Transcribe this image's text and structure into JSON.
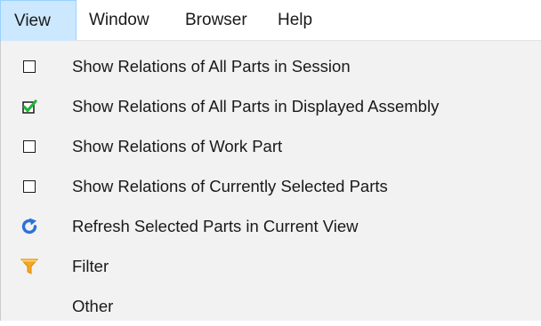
{
  "menubar": {
    "items": [
      {
        "label": "View",
        "active": true
      },
      {
        "label": "Window"
      },
      {
        "label": "Browser"
      },
      {
        "label": "Help"
      }
    ]
  },
  "dropdown": {
    "items": [
      {
        "label": "Show Relations of All Parts in Session",
        "icon": "checkbox-icon",
        "checked": false
      },
      {
        "label": "Show Relations of All Parts in Displayed Assembly",
        "icon": "checkbox-checked-icon",
        "checked": true
      },
      {
        "label": "Show Relations of Work Part",
        "icon": "checkbox-icon",
        "checked": false
      },
      {
        "label": "Show Relations of Currently Selected Parts",
        "icon": "checkbox-icon",
        "checked": false
      },
      {
        "label": "Refresh Selected Parts in Current View",
        "icon": "refresh-icon"
      },
      {
        "label": "Filter",
        "icon": "filter-icon"
      },
      {
        "label": "Other",
        "icon": ""
      }
    ]
  },
  "colors": {
    "active_menu_bg": "#cce8ff",
    "active_menu_border": "#99d1ff",
    "dropdown_bg": "#f2f2f2",
    "check_green": "#1fb53a",
    "refresh_blue": "#2a73d9",
    "filter_orange": "#f5a623"
  }
}
